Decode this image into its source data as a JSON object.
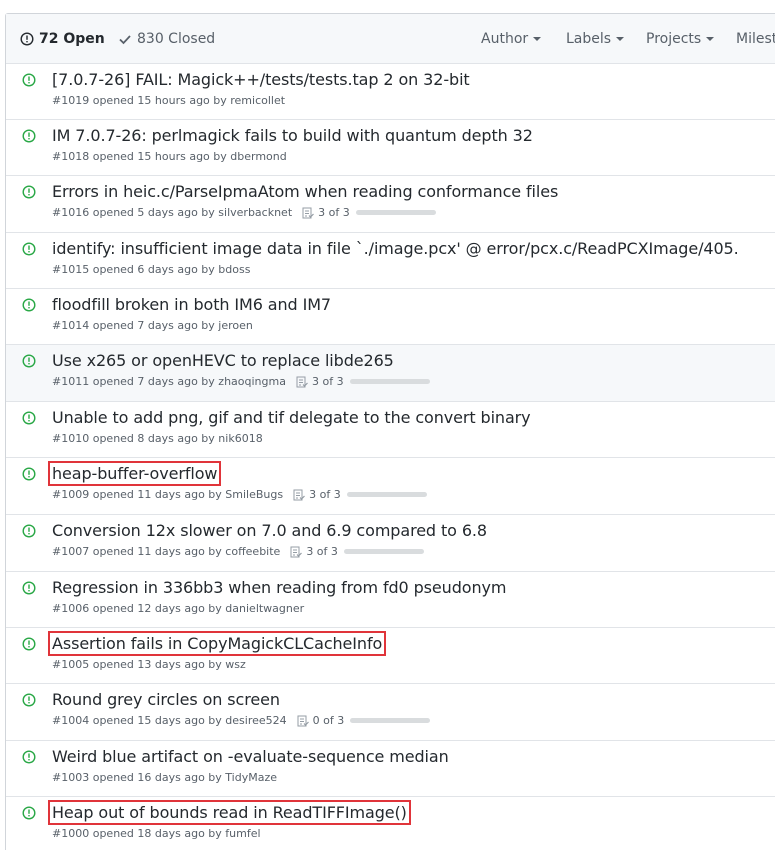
{
  "header": {
    "open_label": "72 Open",
    "closed_label": "830 Closed",
    "filters": [
      "Author",
      "Labels",
      "Projects",
      "Milesto"
    ]
  },
  "issues": [
    {
      "title": "[7.0.7-26] FAIL: Magick++/tests/tests.tap 2 on 32-bit",
      "meta": "#1019 opened 15 hours ago by remicollet"
    },
    {
      "title": "IM 7.0.7-26: perlmagick fails to build with quantum depth 32",
      "meta": "#1018 opened 15 hours ago by dbermond"
    },
    {
      "title": "Errors in heic.c/ParseIpmaAtom when reading conformance files",
      "meta": "#1016 opened 5 days ago by silverbacknet",
      "tasks": "3 of 3"
    },
    {
      "title": "identify: insufficient image data in file `./image.pcx' @ error/pcx.c/ReadPCXImage/405.",
      "meta": "#1015 opened 6 days ago by bdoss"
    },
    {
      "title": "floodfill broken in both IM6 and IM7",
      "meta": "#1014 opened 7 days ago by jeroen"
    },
    {
      "title": "Use x265 or openHEVC to replace libde265",
      "meta": "#1011 opened 7 days ago by zhaoqingma",
      "tasks": "3 of 3"
    },
    {
      "title": "Unable to add png, gif and tif delegate to the convert binary",
      "meta": "#1010 opened 8 days ago by nik6018"
    },
    {
      "title": "heap-buffer-overflow",
      "meta": "#1009 opened 11 days ago by SmileBugs",
      "tasks": "3 of 3"
    },
    {
      "title": "Conversion 12x slower on 7.0 and 6.9 compared to 6.8",
      "meta": "#1007 opened 11 days ago by coffeebite",
      "tasks": "3 of 3"
    },
    {
      "title": "Regression in 336bb3 when reading from fd0 pseudonym",
      "meta": "#1006 opened 12 days ago by danieltwagner"
    },
    {
      "title": "Assertion fails in CopyMagickCLCacheInfo",
      "meta": "#1005 opened 13 days ago by wsz"
    },
    {
      "title": "Round grey circles on screen",
      "meta": "#1004 opened 15 days ago by desiree524",
      "tasks": "0 of 3"
    },
    {
      "title": "Weird blue artifact on -evaluate-sequence median",
      "meta": "#1003 opened 16 days ago by TidyMaze"
    },
    {
      "title": "Heap out of bounds read in ReadTIFFImage()",
      "meta": "#1000 opened 18 days ago by fumfel"
    }
  ],
  "colors": {
    "open_icon": "#28a745",
    "highlight_box": "#e0343a"
  }
}
